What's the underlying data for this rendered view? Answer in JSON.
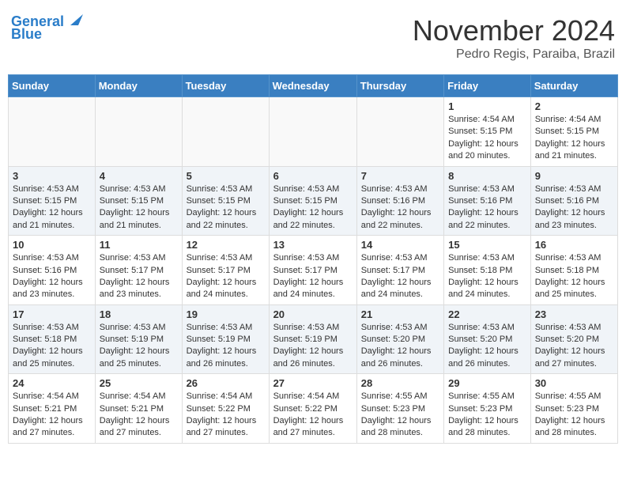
{
  "header": {
    "logo_line1": "General",
    "logo_line2": "Blue",
    "month_year": "November 2024",
    "location": "Pedro Regis, Paraiba, Brazil"
  },
  "weekdays": [
    "Sunday",
    "Monday",
    "Tuesday",
    "Wednesday",
    "Thursday",
    "Friday",
    "Saturday"
  ],
  "weeks": [
    [
      {
        "day": "",
        "info": ""
      },
      {
        "day": "",
        "info": ""
      },
      {
        "day": "",
        "info": ""
      },
      {
        "day": "",
        "info": ""
      },
      {
        "day": "",
        "info": ""
      },
      {
        "day": "1",
        "info": "Sunrise: 4:54 AM\nSunset: 5:15 PM\nDaylight: 12 hours\nand 20 minutes."
      },
      {
        "day": "2",
        "info": "Sunrise: 4:54 AM\nSunset: 5:15 PM\nDaylight: 12 hours\nand 21 minutes."
      }
    ],
    [
      {
        "day": "3",
        "info": "Sunrise: 4:53 AM\nSunset: 5:15 PM\nDaylight: 12 hours\nand 21 minutes."
      },
      {
        "day": "4",
        "info": "Sunrise: 4:53 AM\nSunset: 5:15 PM\nDaylight: 12 hours\nand 21 minutes."
      },
      {
        "day": "5",
        "info": "Sunrise: 4:53 AM\nSunset: 5:15 PM\nDaylight: 12 hours\nand 22 minutes."
      },
      {
        "day": "6",
        "info": "Sunrise: 4:53 AM\nSunset: 5:15 PM\nDaylight: 12 hours\nand 22 minutes."
      },
      {
        "day": "7",
        "info": "Sunrise: 4:53 AM\nSunset: 5:16 PM\nDaylight: 12 hours\nand 22 minutes."
      },
      {
        "day": "8",
        "info": "Sunrise: 4:53 AM\nSunset: 5:16 PM\nDaylight: 12 hours\nand 22 minutes."
      },
      {
        "day": "9",
        "info": "Sunrise: 4:53 AM\nSunset: 5:16 PM\nDaylight: 12 hours\nand 23 minutes."
      }
    ],
    [
      {
        "day": "10",
        "info": "Sunrise: 4:53 AM\nSunset: 5:16 PM\nDaylight: 12 hours\nand 23 minutes."
      },
      {
        "day": "11",
        "info": "Sunrise: 4:53 AM\nSunset: 5:17 PM\nDaylight: 12 hours\nand 23 minutes."
      },
      {
        "day": "12",
        "info": "Sunrise: 4:53 AM\nSunset: 5:17 PM\nDaylight: 12 hours\nand 24 minutes."
      },
      {
        "day": "13",
        "info": "Sunrise: 4:53 AM\nSunset: 5:17 PM\nDaylight: 12 hours\nand 24 minutes."
      },
      {
        "day": "14",
        "info": "Sunrise: 4:53 AM\nSunset: 5:17 PM\nDaylight: 12 hours\nand 24 minutes."
      },
      {
        "day": "15",
        "info": "Sunrise: 4:53 AM\nSunset: 5:18 PM\nDaylight: 12 hours\nand 24 minutes."
      },
      {
        "day": "16",
        "info": "Sunrise: 4:53 AM\nSunset: 5:18 PM\nDaylight: 12 hours\nand 25 minutes."
      }
    ],
    [
      {
        "day": "17",
        "info": "Sunrise: 4:53 AM\nSunset: 5:18 PM\nDaylight: 12 hours\nand 25 minutes."
      },
      {
        "day": "18",
        "info": "Sunrise: 4:53 AM\nSunset: 5:19 PM\nDaylight: 12 hours\nand 25 minutes."
      },
      {
        "day": "19",
        "info": "Sunrise: 4:53 AM\nSunset: 5:19 PM\nDaylight: 12 hours\nand 26 minutes."
      },
      {
        "day": "20",
        "info": "Sunrise: 4:53 AM\nSunset: 5:19 PM\nDaylight: 12 hours\nand 26 minutes."
      },
      {
        "day": "21",
        "info": "Sunrise: 4:53 AM\nSunset: 5:20 PM\nDaylight: 12 hours\nand 26 minutes."
      },
      {
        "day": "22",
        "info": "Sunrise: 4:53 AM\nSunset: 5:20 PM\nDaylight: 12 hours\nand 26 minutes."
      },
      {
        "day": "23",
        "info": "Sunrise: 4:53 AM\nSunset: 5:20 PM\nDaylight: 12 hours\nand 27 minutes."
      }
    ],
    [
      {
        "day": "24",
        "info": "Sunrise: 4:54 AM\nSunset: 5:21 PM\nDaylight: 12 hours\nand 27 minutes."
      },
      {
        "day": "25",
        "info": "Sunrise: 4:54 AM\nSunset: 5:21 PM\nDaylight: 12 hours\nand 27 minutes."
      },
      {
        "day": "26",
        "info": "Sunrise: 4:54 AM\nSunset: 5:22 PM\nDaylight: 12 hours\nand 27 minutes."
      },
      {
        "day": "27",
        "info": "Sunrise: 4:54 AM\nSunset: 5:22 PM\nDaylight: 12 hours\nand 27 minutes."
      },
      {
        "day": "28",
        "info": "Sunrise: 4:55 AM\nSunset: 5:23 PM\nDaylight: 12 hours\nand 28 minutes."
      },
      {
        "day": "29",
        "info": "Sunrise: 4:55 AM\nSunset: 5:23 PM\nDaylight: 12 hours\nand 28 minutes."
      },
      {
        "day": "30",
        "info": "Sunrise: 4:55 AM\nSunset: 5:23 PM\nDaylight: 12 hours\nand 28 minutes."
      }
    ]
  ]
}
